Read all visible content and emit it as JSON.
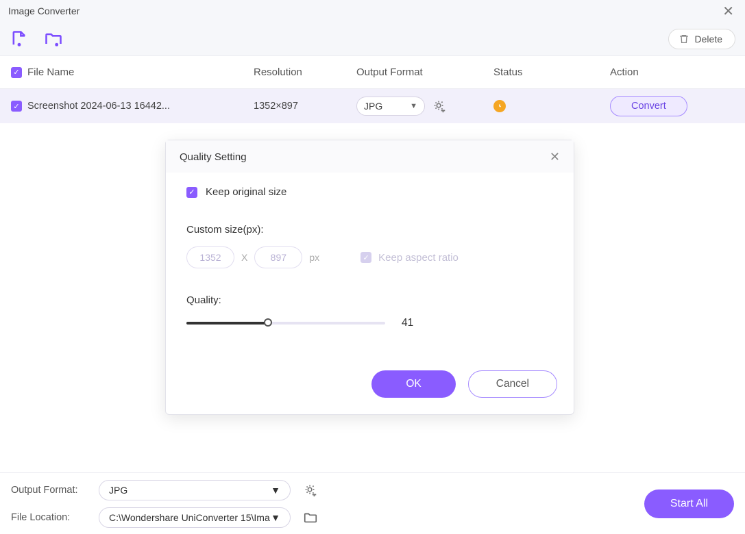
{
  "window": {
    "title": "Image Converter"
  },
  "toolbar": {
    "delete_label": "Delete"
  },
  "columns": {
    "name": "File Name",
    "resolution": "Resolution",
    "format": "Output Format",
    "status": "Status",
    "action": "Action"
  },
  "file": {
    "name": "Screenshot 2024-06-13 16442...",
    "resolution": "1352×897",
    "format": "JPG",
    "convert_label": "Convert"
  },
  "modal": {
    "title": "Quality Setting",
    "keep_original": "Keep original size",
    "custom_size_label": "Custom size(px):",
    "width": "1352",
    "height": "897",
    "x": "X",
    "px": "px",
    "aspect": "Keep aspect ratio",
    "quality_label": "Quality:",
    "quality_value": "41",
    "slider_percent": 41,
    "ok": "OK",
    "cancel": "Cancel"
  },
  "bottom": {
    "output_format_label": "Output Format:",
    "output_format_value": "JPG",
    "file_location_label": "File Location:",
    "file_location_value": "C:\\Wondershare UniConverter 15\\Ima",
    "start_all": "Start All"
  }
}
